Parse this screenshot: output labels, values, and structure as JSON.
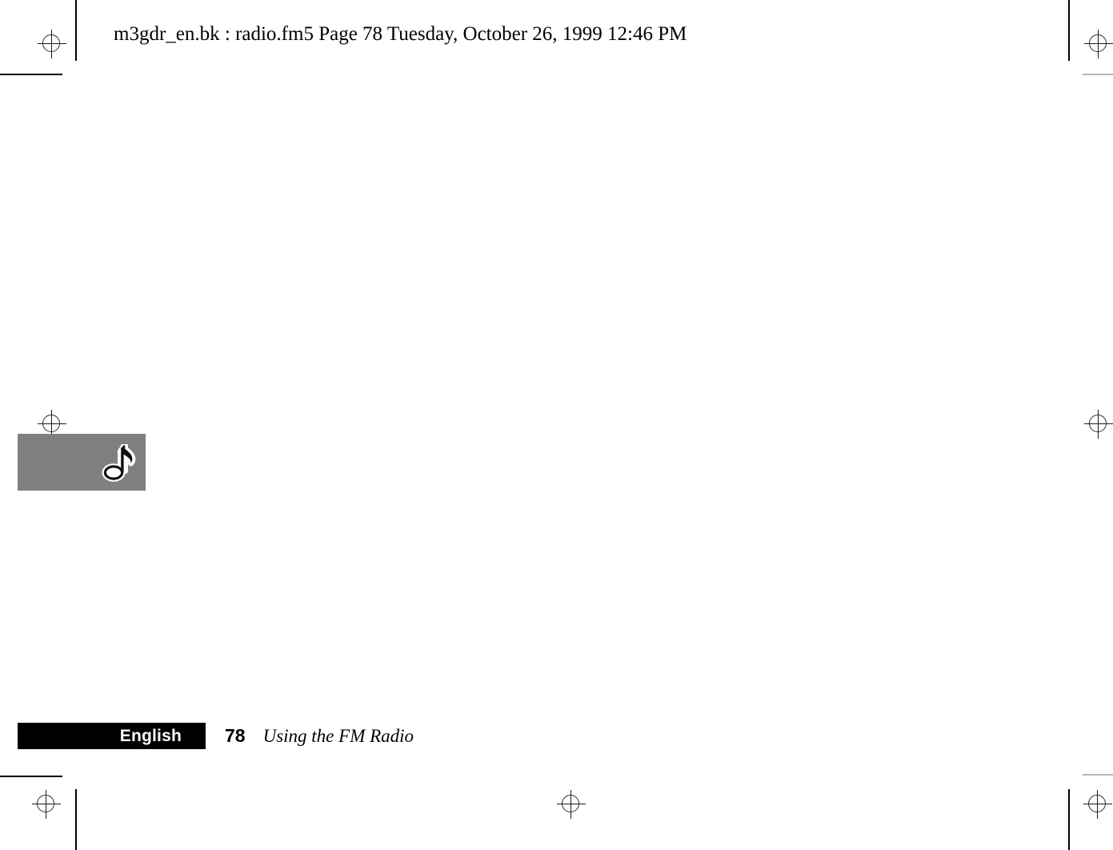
{
  "header": {
    "proof_line": "m3gdr_en.bk : radio.fm5  Page 78  Tuesday, October 26, 1999  12:46 PM"
  },
  "content": {
    "icon_panel": {
      "icon": "music-note-icon",
      "background_color": "#808080",
      "note_fill_color": "#000000",
      "note_outline_color": "#ffffff"
    }
  },
  "footer": {
    "language_label": "English",
    "language_bar_color": "#000000",
    "language_text_color": "#ffffff",
    "page_number": "78",
    "section_title": "Using the FM Radio"
  },
  "printer_marks": {
    "registration_mark": "registration-target-icon",
    "crop_mark": "crop-line",
    "mark_color": "#000000",
    "light_mark_color": "#b4b4b4"
  }
}
